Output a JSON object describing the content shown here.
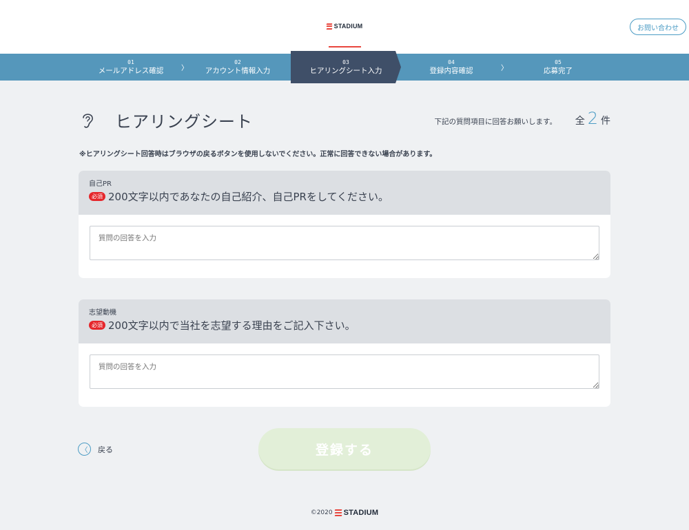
{
  "header": {
    "brand": "STADIUM",
    "contact_label": "お問い合わせ"
  },
  "steps": [
    {
      "num": "01",
      "label": "メールアドレス確認",
      "state": "done"
    },
    {
      "num": "02",
      "label": "アカウント情報入力",
      "state": "done"
    },
    {
      "num": "03",
      "label": "ヒアリングシート入力",
      "state": "active"
    },
    {
      "num": "04",
      "label": "登録内容確認",
      "state": "pending"
    },
    {
      "num": "05",
      "label": "応募完了",
      "state": "pending"
    }
  ],
  "page": {
    "title": "ヒアリングシート",
    "hint": "下記の質問項目に回答お願いします。",
    "count_prefix": "全",
    "count_value": "2",
    "count_suffix": "件",
    "notice": "※ヒアリングシート回答時はブラウザの戻るボタンを使用しないでください。正常に回答できない場合があります。"
  },
  "questions": [
    {
      "category": "自己PR",
      "required_label": "必須",
      "text": "200文字以内であなたの自己紹介、自己PRをしてください。",
      "placeholder": "質問の回答を入力",
      "value": ""
    },
    {
      "category": "志望動機",
      "required_label": "必須",
      "text": "200文字以内で当社を志望する理由をご記入下さい。",
      "placeholder": "質問の回答を入力",
      "value": ""
    }
  ],
  "actions": {
    "back_label": "戻る",
    "submit_label": "登録する"
  },
  "footer": {
    "copyright": "©2020",
    "brand": "STADIUM"
  },
  "colors": {
    "accent": "#4a9bc4",
    "step_bar": "#5597bb",
    "step_active": "#3f4f68",
    "brand_red": "#e8453c",
    "required_red": "#e5262b",
    "submit_disabled": "#e2efd8"
  }
}
